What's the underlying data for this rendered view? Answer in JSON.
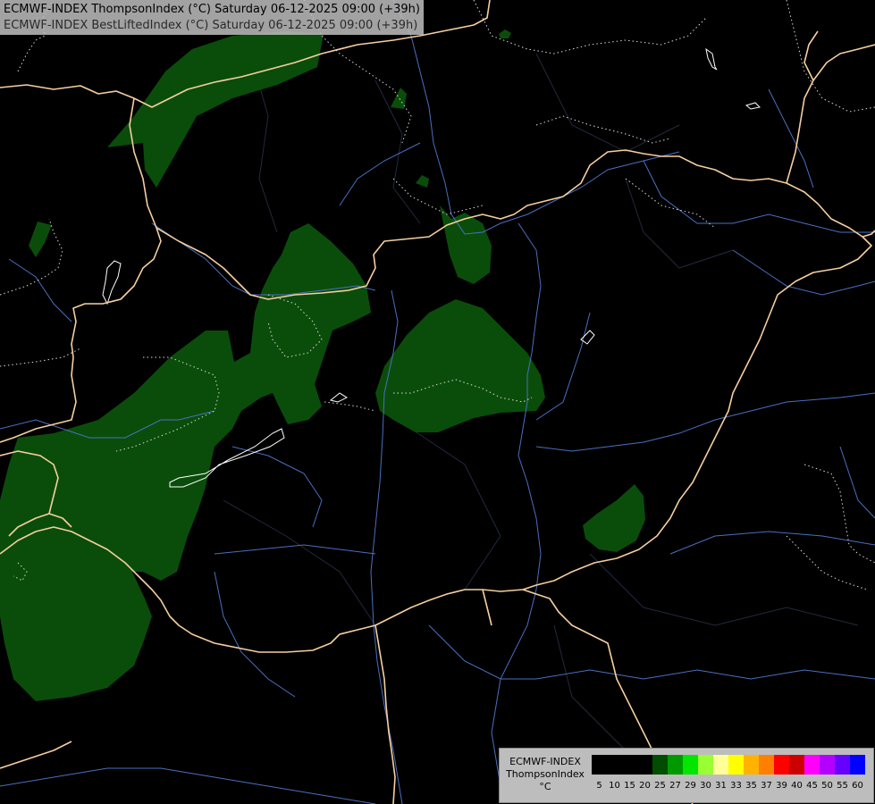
{
  "header": {
    "line1": "ECMWF-INDEX ThompsonIndex (°C) Saturday 06-12-2025 09:00 (+39h)",
    "line2": "ECMWF-INDEX BestLiftedIndex (°C) Saturday 06-12-2025 09:00 (+39h)"
  },
  "legend": {
    "line1": "ECMWF-INDEX",
    "line2": "ThompsonIndex",
    "line3": "°C",
    "ticks": [
      "5",
      "10",
      "15",
      "20",
      "25",
      "27",
      "29",
      "30",
      "31",
      "33",
      "35",
      "37",
      "39",
      "40",
      "45",
      "50",
      "55",
      "60"
    ],
    "colors": [
      "#000000",
      "#000000",
      "#000000",
      "#000000",
      "#004d00",
      "#009900",
      "#00e600",
      "#99ff33",
      "#ffff99",
      "#ffff00",
      "#ffb300",
      "#ff8000",
      "#ff0000",
      "#cc0000",
      "#ff00ff",
      "#b300ff",
      "#6600ff",
      "#0000ff"
    ]
  },
  "map": {
    "colors": {
      "background": "#000000",
      "shading": "#0a4d0a",
      "borders": "#f5cfa0",
      "rivers": "#4a6fbf",
      "admin": "#2a3550",
      "contours": "#d8d8d8"
    }
  }
}
